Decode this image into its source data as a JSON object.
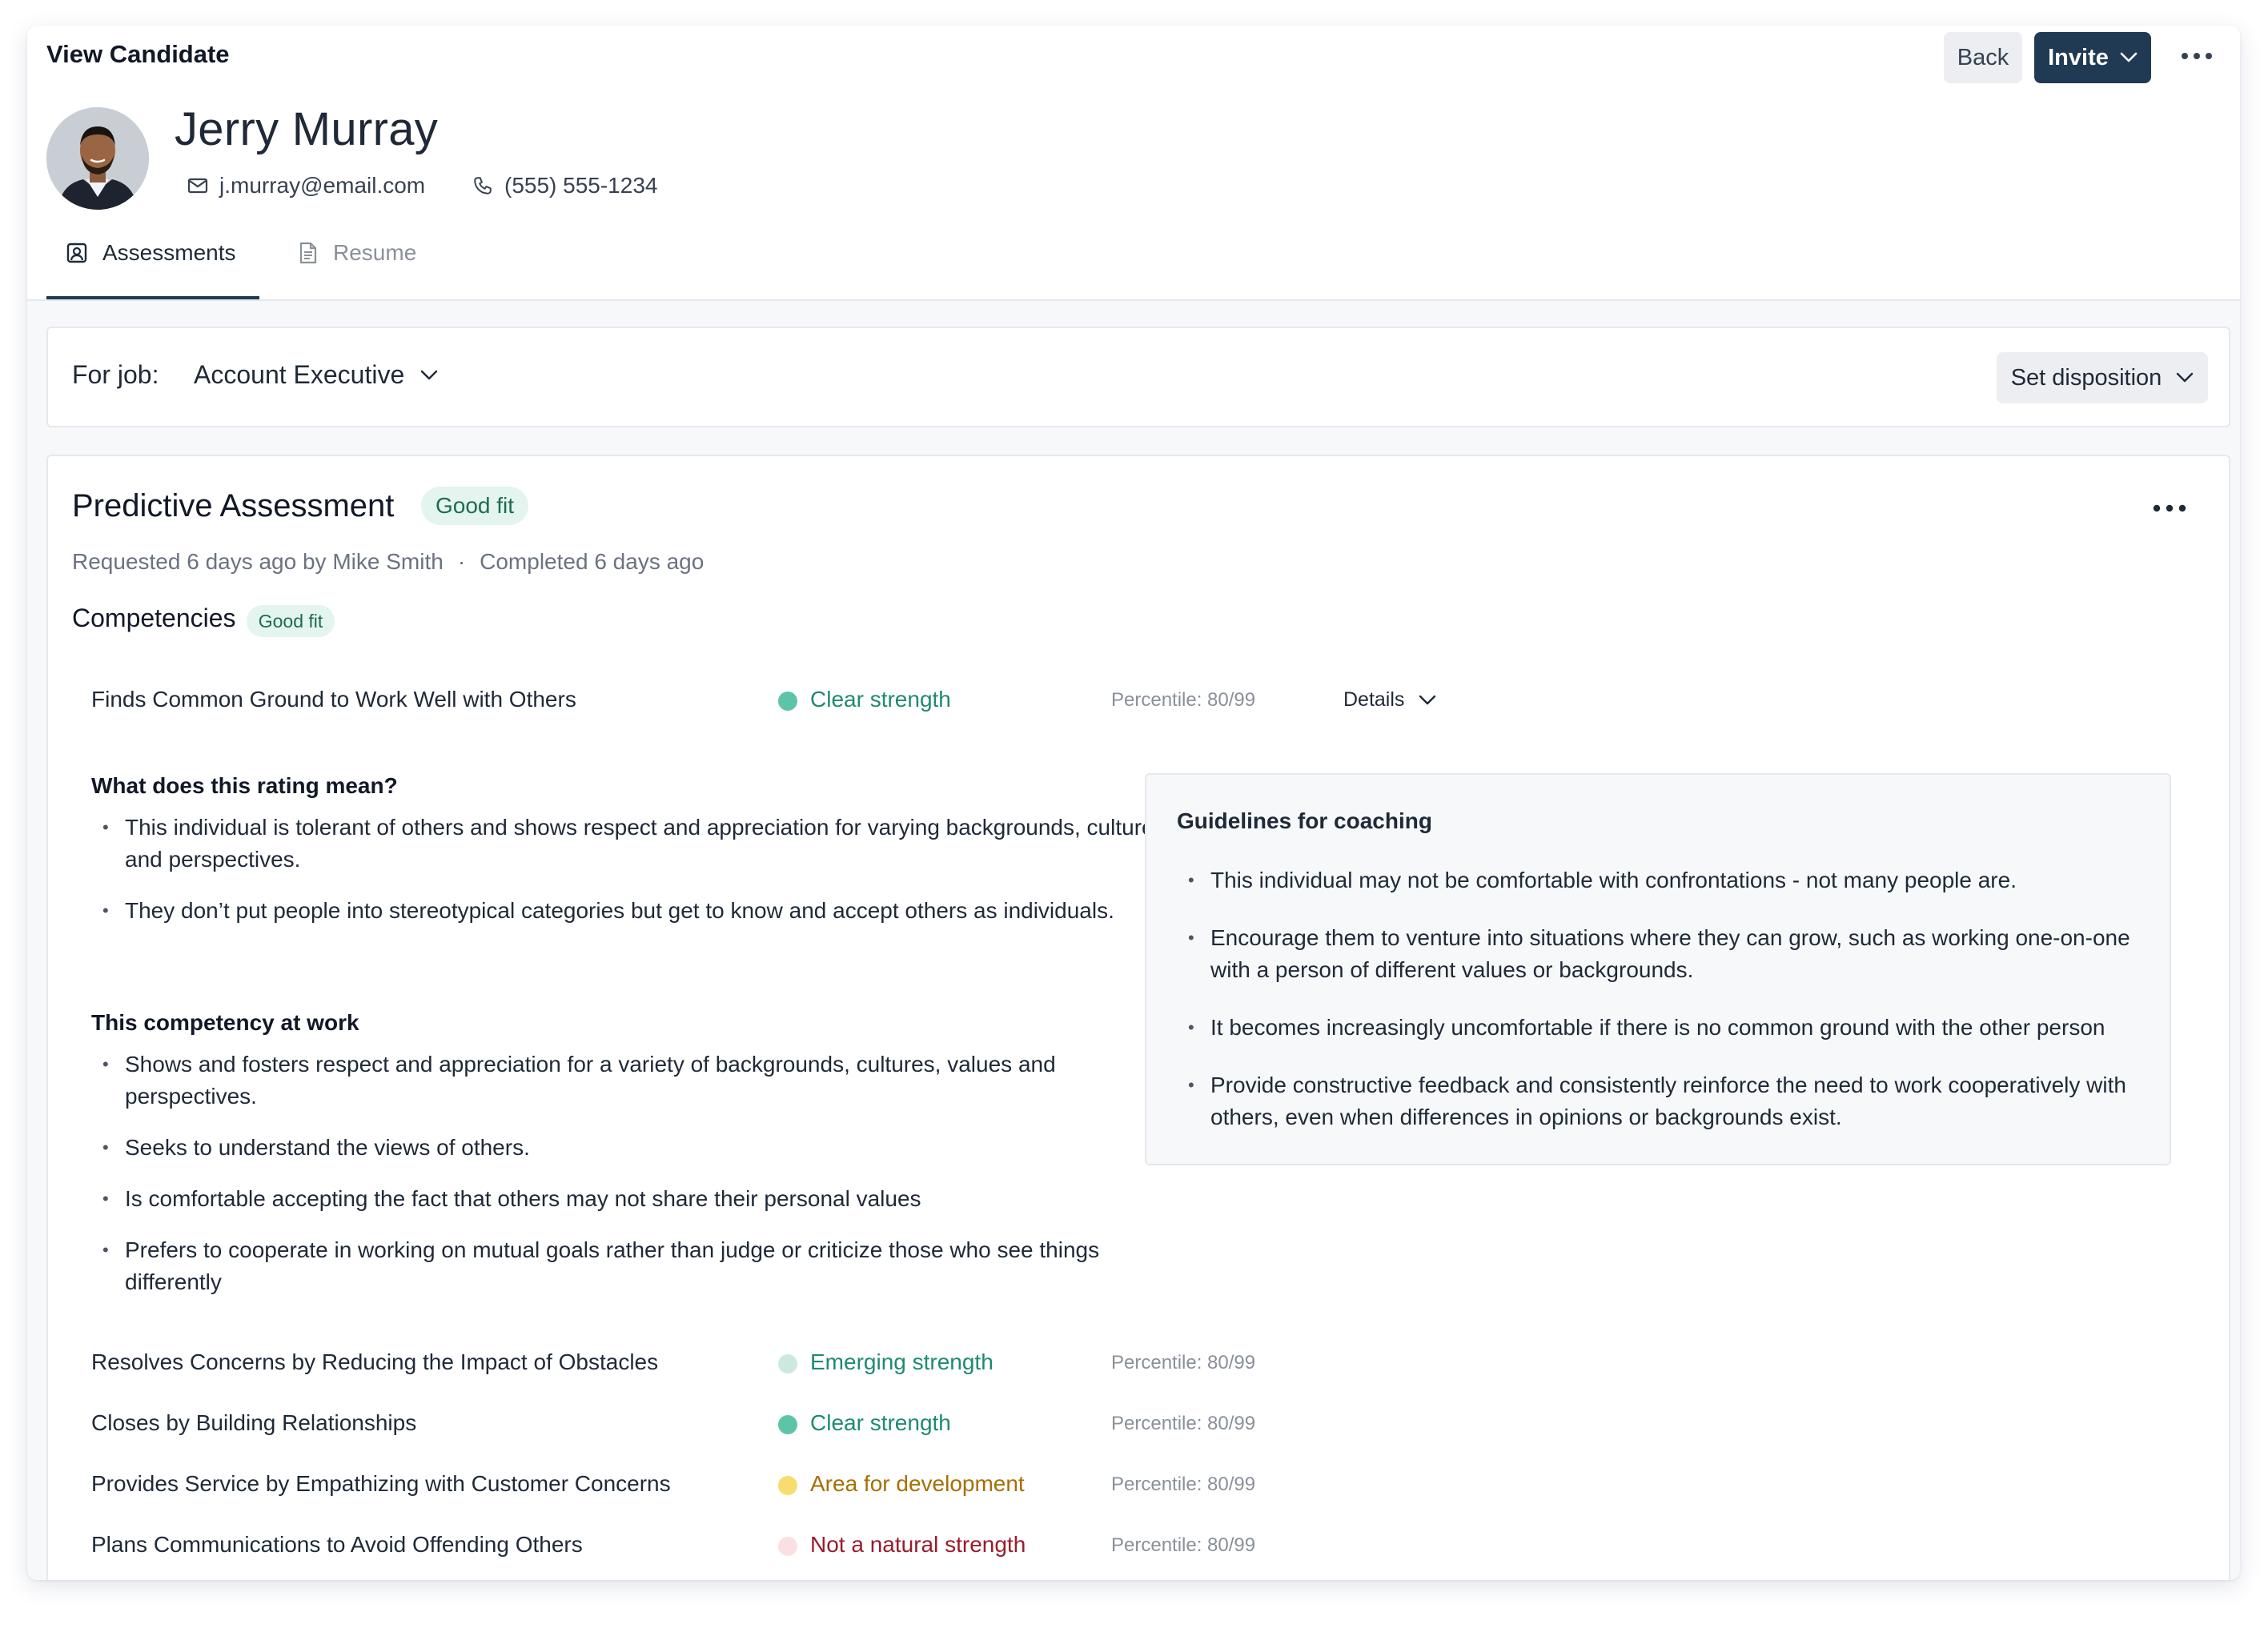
{
  "header": {
    "title": "View Candidate",
    "back_label": "Back",
    "invite_label": "Invite"
  },
  "candidate": {
    "name": "Jerry Murray",
    "email": "j.murray@email.com",
    "phone": "(555) 555-1234"
  },
  "tabs": [
    {
      "label": "Assessments",
      "icon": "assessment-icon",
      "active": true
    },
    {
      "label": "Resume",
      "icon": "document-icon",
      "active": false
    }
  ],
  "job": {
    "label": "For job:",
    "value": "Account Executive",
    "disposition_label": "Set disposition"
  },
  "assessment": {
    "title": "Predictive Assessment",
    "fit_badge": "Good fit",
    "requested": "Requested 6 days ago by Mike Smith",
    "separator": "·",
    "completed": "Completed 6 days ago",
    "competencies_title": "Competencies",
    "competencies_badge": "Good fit",
    "details_label": "Details",
    "competencies": [
      {
        "name": "Finds Common Ground to Work Well with Others",
        "rating": "Clear strength",
        "percentile": "Percentile: 80/99",
        "dot_color": "#5ec4a7",
        "text_color": "#1e8a71"
      },
      {
        "name": "Resolves Concerns by Reducing the Impact of Obstacles",
        "rating": "Emerging strength",
        "percentile": "Percentile: 80/99",
        "dot_color": "#cde9df",
        "text_color": "#1e8a71"
      },
      {
        "name": "Closes by Building Relationships",
        "rating": "Clear strength",
        "percentile": "Percentile: 80/99",
        "dot_color": "#5ec4a7",
        "text_color": "#1e8a71"
      },
      {
        "name": "Provides Service by Empathizing with Customer Concerns",
        "rating": "Area for development",
        "percentile": "Percentile: 80/99",
        "dot_color": "#f7dc6f",
        "text_color": "#a66f00"
      },
      {
        "name": "Plans Communications to Avoid Offending Others",
        "rating": "Not a natural strength",
        "percentile": "Percentile: 80/99",
        "dot_color": "#fbe0e2",
        "text_color": "#9b1b2a"
      }
    ],
    "rating_meaning": {
      "title": "What does this rating mean?",
      "items": [
        "This individual is tolerant of others and shows respect and appreciation for varying backgrounds, cultures, and perspectives.",
        "They don’t put people into stereotypical categories but get to know and accept others as individuals."
      ]
    },
    "at_work": {
      "title": "This competency at work",
      "items": [
        "Shows and fosters respect and appreciation for a variety of backgrounds, cultures, values and perspectives.",
        "Seeks to understand the views of others.",
        "Is comfortable accepting the fact that others may not share their personal values",
        "Prefers to cooperate in working on mutual goals rather than judge or criticize those who see things differently"
      ]
    },
    "coaching": {
      "title": "Guidelines for coaching",
      "items": [
        "This individual may not be comfortable with confrontations - not many people are.",
        "Encourage them to venture into situations where they can grow, such as working one-on-one with a person of different values or backgrounds.",
        "It becomes increasingly uncomfortable if there is no common ground with the other person",
        "Provide constructive feedback and consistently reinforce the need to work cooperatively with others, even when differences in opinions or backgrounds exist."
      ]
    }
  },
  "colors": {
    "primary": "#213a53",
    "badge_bg": "#e4f4ee",
    "badge_text": "#1f6b55"
  }
}
